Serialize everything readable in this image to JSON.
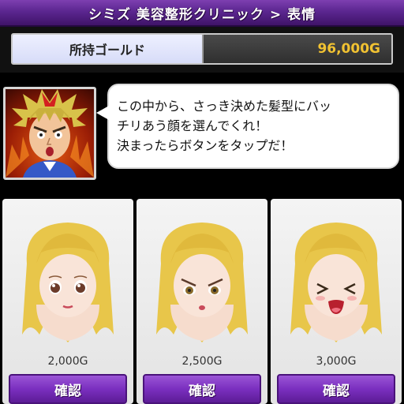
{
  "header": {
    "title": "シミズ 美容整形クリニック > 表情"
  },
  "gold": {
    "label": "所持ゴールド",
    "value": "96,000G"
  },
  "speech": {
    "lines": [
      "この中から、さっき決めた髪型にバッ",
      "チリあう顔を選んでくれ！",
      "決まったらボタンをタップだ！"
    ]
  },
  "portrait": {
    "icon": "spiky-hair-character-portrait"
  },
  "cards": [
    {
      "expression": "neutral",
      "price": "2,000G",
      "button_label": "確認"
    },
    {
      "expression": "angry",
      "price": "2,500G",
      "button_label": "確認"
    },
    {
      "expression": "laughing",
      "price": "3,000G",
      "button_label": "確認"
    }
  ],
  "colors": {
    "accent_purple": "#7a2fbf",
    "gold_text": "#f1c232",
    "hair": "#e8c64a"
  }
}
